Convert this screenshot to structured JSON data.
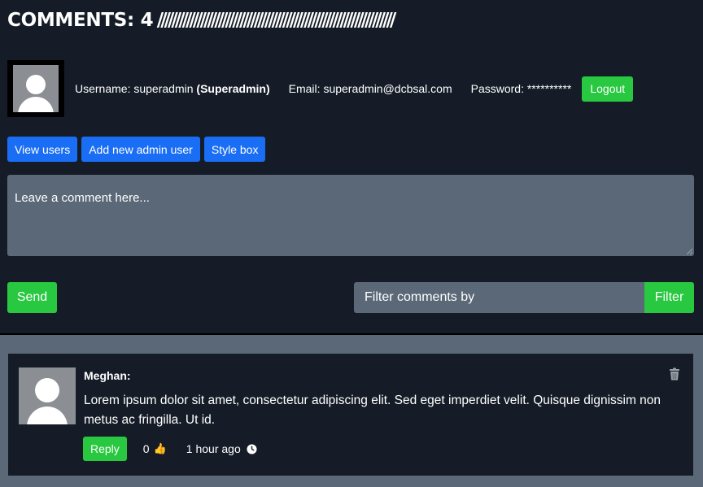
{
  "header": {
    "title": "COMMENTS: 4",
    "stripes": "//////////////////////////////////////////////////////////////////"
  },
  "user": {
    "username_label": "Username:",
    "username": "superadmin",
    "role": "(Superadmin)",
    "email_label": "Email:",
    "email": "superadmin@dcbsal.com",
    "password_label": "Password:",
    "password": "**********",
    "logout_label": "Logout",
    "avatar_icon": "user-silhouette-icon"
  },
  "admin_buttons": {
    "view_users": "View users",
    "add_admin": "Add new admin user",
    "style_box": "Style box"
  },
  "comment_form": {
    "placeholder": "Leave a comment here...",
    "send_label": "Send",
    "filter_placeholder": "Filter comments by",
    "filter_label": "Filter"
  },
  "comments": [
    {
      "author": "Meghan:",
      "text": "Lorem ipsum dolor sit amet, consectetur adipiscing elit. Sed eget imperdiet velit. Quisque dignissim non metus ac fringilla. Ut id.",
      "reply_label": "Reply",
      "likes": "0",
      "like_icon": "thumbs-up-icon",
      "time": "1 hour ago",
      "time_icon": "clock-icon",
      "delete_icon": "trash-icon"
    }
  ],
  "colors": {
    "background": "#151c27",
    "panel": "#5a6877",
    "green": "#28c840",
    "blue": "#1a6ef5"
  }
}
